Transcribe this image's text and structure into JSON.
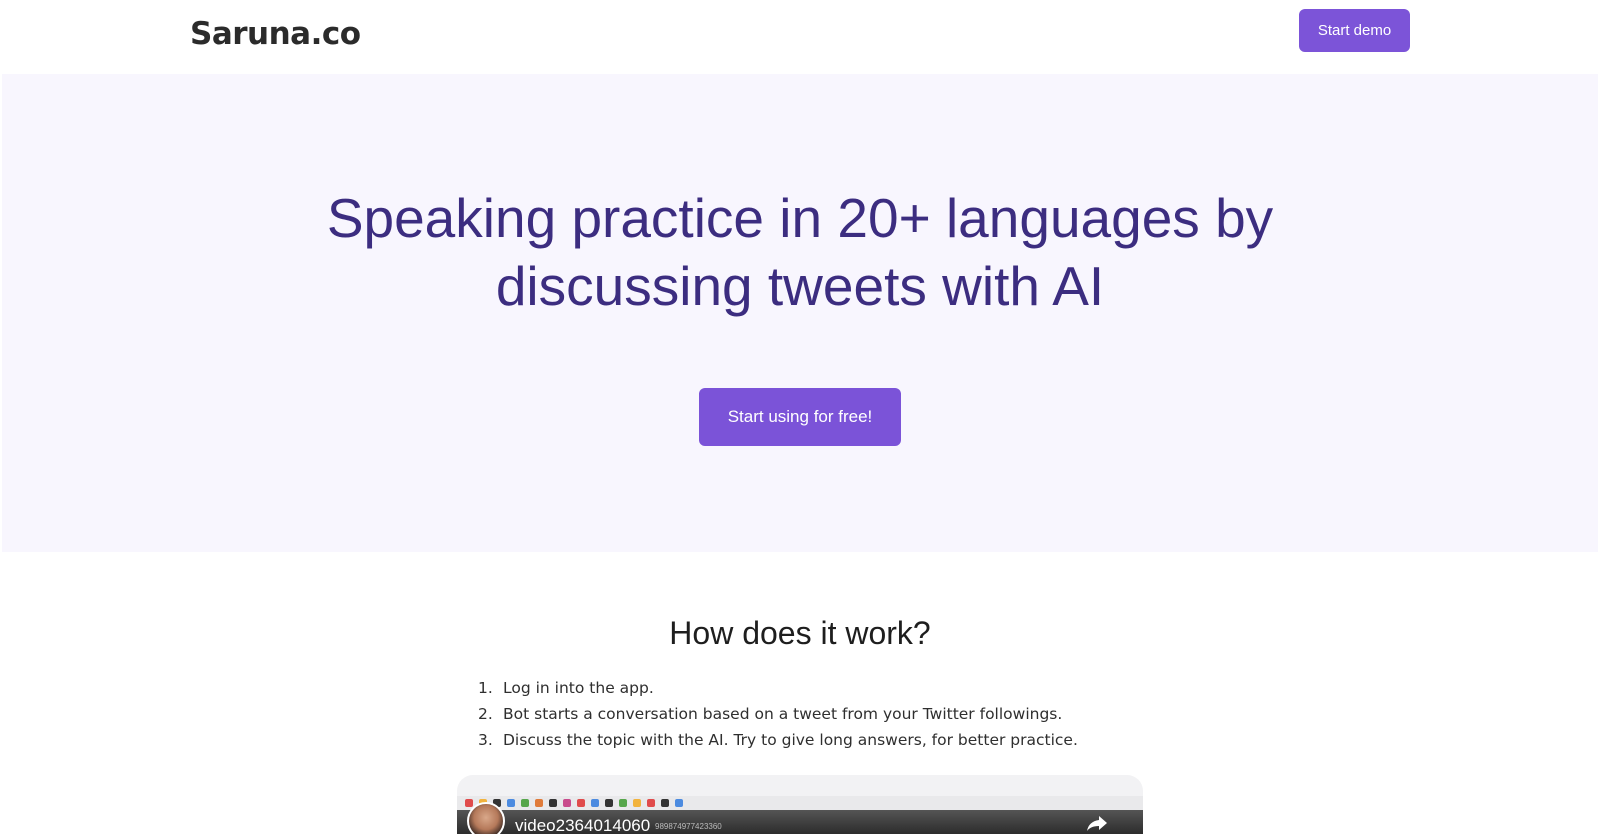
{
  "header": {
    "brand": "Saruna.co",
    "demo_button": "Start demo"
  },
  "hero": {
    "title_line1": "Speaking practice in 20+ languages by",
    "title_line2": "discussing tweets with AI",
    "cta_button": "Start using for free!"
  },
  "how": {
    "title": "How does it work?",
    "steps": [
      {
        "num": "1.",
        "text": "Log in into the app."
      },
      {
        "num": "2.",
        "text": "Bot starts a conversation based on a tweet from your Twitter followings."
      },
      {
        "num": "3.",
        "text": "Discuss the topic with the AI. Try to give long answers, for better practice."
      }
    ]
  },
  "video": {
    "title": "video2364014060",
    "subtitle": "989874977423360",
    "icon": "share-icon"
  },
  "colors": {
    "accent": "#7c54d8",
    "hero_bg": "#f8f6fe",
    "hero_title": "#3c2d80"
  }
}
